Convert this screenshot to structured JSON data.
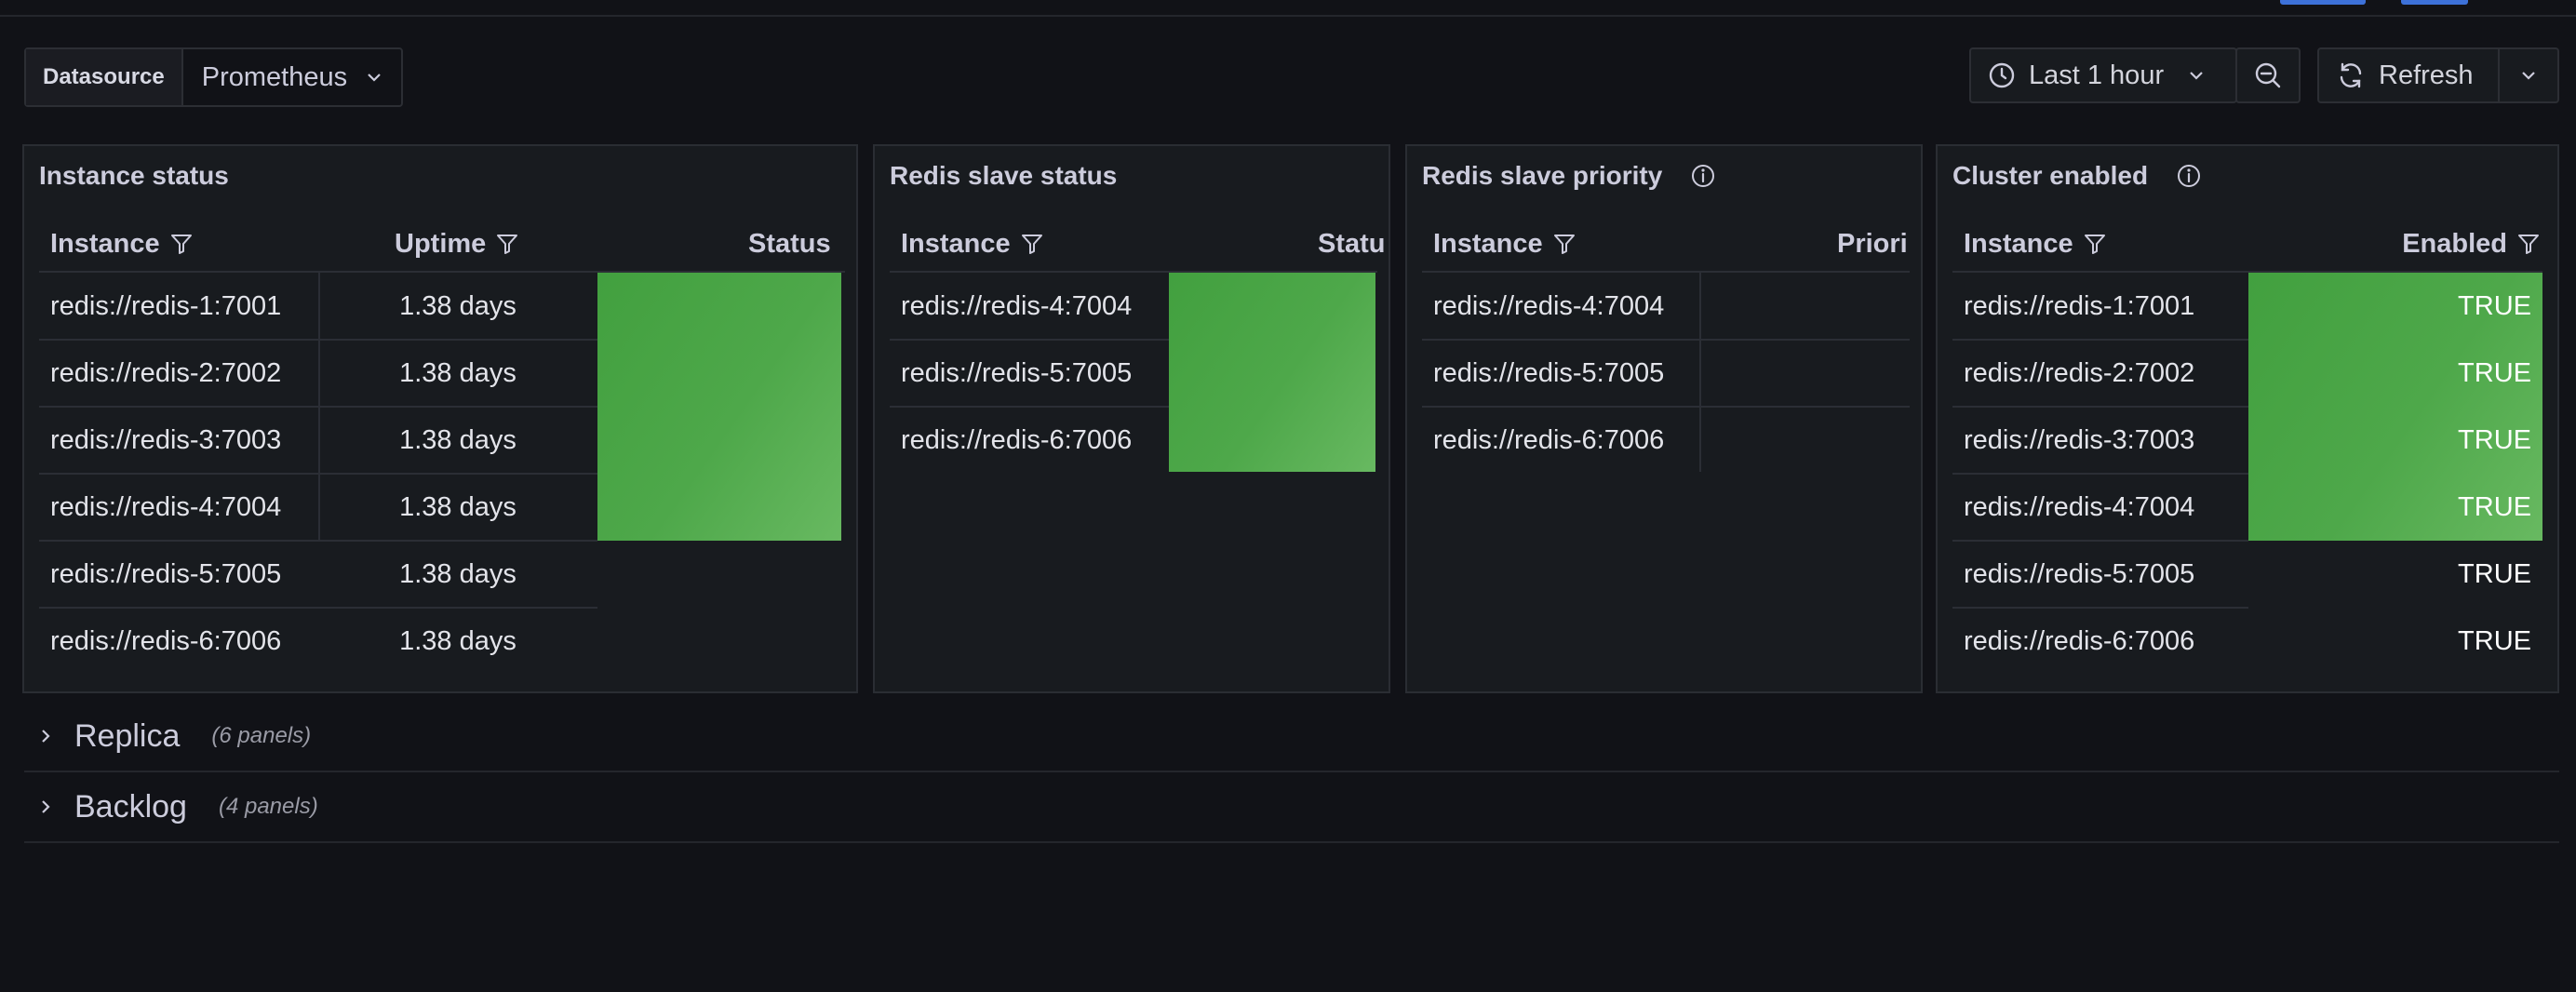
{
  "variables": {
    "label": "Datasource",
    "value": "Prometheus"
  },
  "time_picker": {
    "label": "Last 1 hour"
  },
  "refresh": {
    "label": "Refresh"
  },
  "panels": {
    "instance_status": {
      "title": "Instance status",
      "headers": {
        "instance": "Instance",
        "uptime": "Uptime",
        "status": "Status"
      },
      "rows": [
        {
          "instance": "redis://redis-1:7001",
          "uptime": "1.38 days"
        },
        {
          "instance": "redis://redis-2:7002",
          "uptime": "1.38 days"
        },
        {
          "instance": "redis://redis-3:7003",
          "uptime": "1.38 days"
        },
        {
          "instance": "redis://redis-4:7004",
          "uptime": "1.38 days"
        },
        {
          "instance": "redis://redis-5:7005",
          "uptime": "1.38 days"
        },
        {
          "instance": "redis://redis-6:7006",
          "uptime": "1.38 days"
        }
      ]
    },
    "slave_status": {
      "title": "Redis slave status",
      "headers": {
        "instance": "Instance",
        "status": "Statu"
      },
      "rows": [
        {
          "instance": "redis://redis-4:7004"
        },
        {
          "instance": "redis://redis-5:7005"
        },
        {
          "instance": "redis://redis-6:7006"
        }
      ]
    },
    "slave_priority": {
      "title": "Redis slave priority",
      "headers": {
        "instance": "Instance",
        "priority": "Priori"
      },
      "rows": [
        {
          "instance": "redis://redis-4:7004"
        },
        {
          "instance": "redis://redis-5:7005"
        },
        {
          "instance": "redis://redis-6:7006"
        }
      ]
    },
    "cluster_enabled": {
      "title": "Cluster enabled",
      "headers": {
        "instance": "Instance",
        "enabled": "Enabled"
      },
      "rows": [
        {
          "instance": "redis://redis-1:7001",
          "enabled": "TRUE"
        },
        {
          "instance": "redis://redis-2:7002",
          "enabled": "TRUE"
        },
        {
          "instance": "redis://redis-3:7003",
          "enabled": "TRUE"
        },
        {
          "instance": "redis://redis-4:7004",
          "enabled": "TRUE"
        },
        {
          "instance": "redis://redis-5:7005",
          "enabled": "TRUE"
        },
        {
          "instance": "redis://redis-6:7006",
          "enabled": "TRUE"
        }
      ]
    }
  },
  "rows": [
    {
      "title": "Replica",
      "subtitle": "(6 panels)"
    },
    {
      "title": "Backlog",
      "subtitle": "(4 panels)"
    }
  ],
  "colors": {
    "background": "#111217",
    "panel": "#181b1f",
    "ok_green": "#4ea84a",
    "border": "#2a2d33"
  }
}
